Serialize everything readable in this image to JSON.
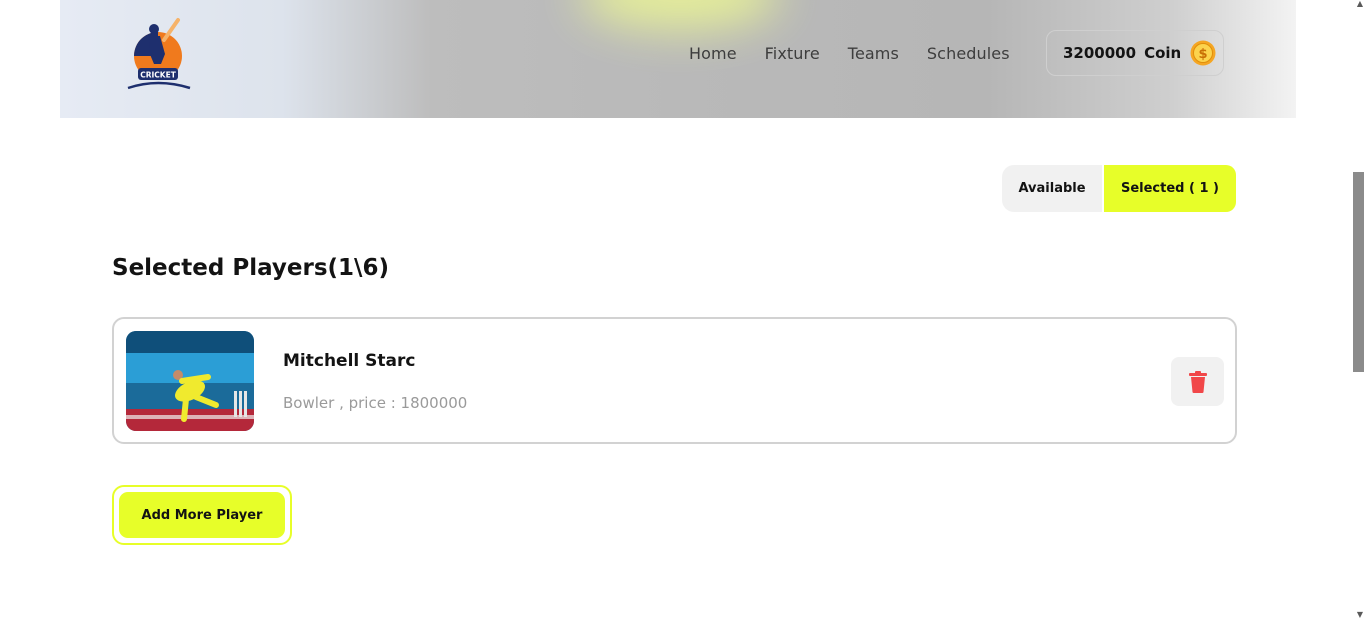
{
  "header": {
    "logo_text": "CRICKET",
    "nav": [
      {
        "label": "Home"
      },
      {
        "label": "Fixture"
      },
      {
        "label": "Teams"
      },
      {
        "label": "Schedules"
      }
    ],
    "coins": {
      "amount": "3200000",
      "unit": "Coin",
      "icon": "coin-icon"
    }
  },
  "toggle": {
    "available_label": "Available",
    "selected_label": "Selected ( 1 )",
    "active": "selected"
  },
  "section": {
    "title": "Selected Players(1\\6)"
  },
  "players": [
    {
      "name": "Mitchell Starc",
      "meta": "Bowler , price : 1800000",
      "delete_icon": "trash-icon"
    }
  ],
  "actions": {
    "add_more_label": "Add More Player"
  },
  "colors": {
    "accent": "#E7FE29",
    "delete": "#F14749",
    "text": "#131313",
    "muted": "#9A9A9A"
  }
}
